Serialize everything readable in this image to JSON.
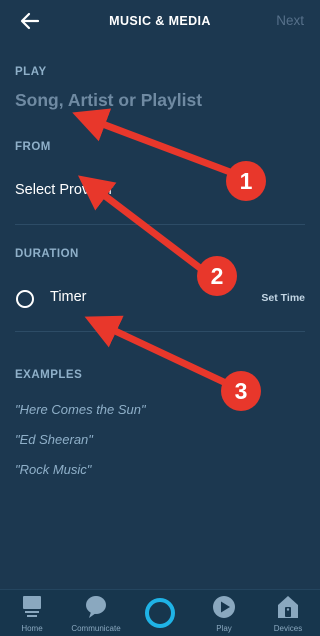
{
  "header": {
    "title": "MUSIC & MEDIA",
    "next_label": "Next"
  },
  "play": {
    "label": "PLAY",
    "placeholder": "Song, Artist or Playlist"
  },
  "from": {
    "label": "FROM",
    "value": "Select Provider"
  },
  "duration": {
    "label": "DURATION",
    "timer_label": "Timer",
    "set_time_label": "Set Time"
  },
  "examples": {
    "label": "EXAMPLES",
    "items": [
      "\"Here Comes the Sun\"",
      "\"Ed Sheeran\"",
      "\"Rock Music\""
    ]
  },
  "callouts": [
    "1",
    "2",
    "3"
  ],
  "nav": {
    "home": "Home",
    "communicate": "Communicate",
    "play": "Play",
    "devices": "Devices"
  },
  "colors": {
    "background": "#1c3850",
    "accent": "#1fb3e6",
    "callout": "#e8372b"
  }
}
